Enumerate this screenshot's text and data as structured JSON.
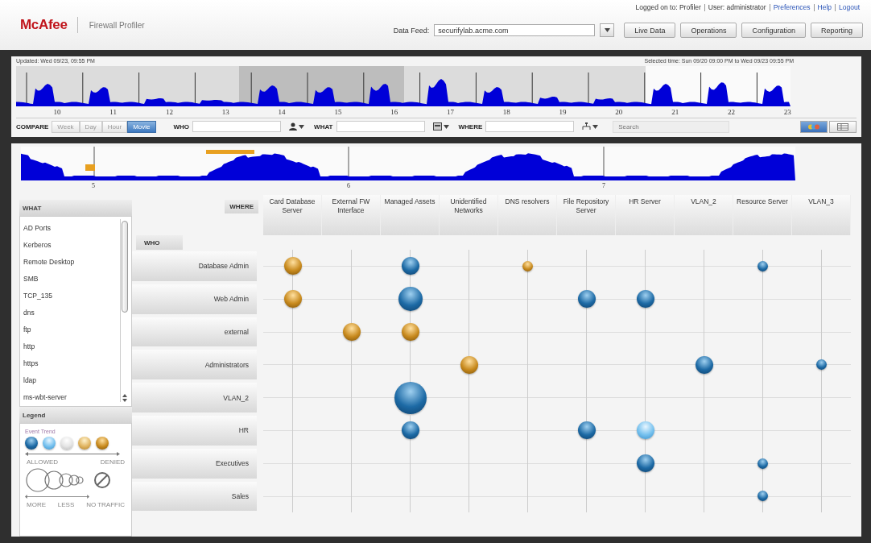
{
  "header": {
    "logo": "McAfee",
    "product": "Firewall Profiler",
    "session": [
      {
        "kind": "text",
        "label": "Logged on to: Profiler"
      },
      {
        "kind": "text",
        "label": "User: administrator"
      },
      {
        "kind": "link",
        "label": "Preferences"
      },
      {
        "kind": "link",
        "label": "Help"
      },
      {
        "kind": "link",
        "label": "Logout"
      }
    ],
    "data_feed": {
      "label": "Data Feed:",
      "value": "securifylab.acme.com"
    },
    "buttons": [
      "Live Data",
      "Operations",
      "Configuration",
      "Reporting"
    ]
  },
  "timeline": {
    "updated": "Updated: Wed 09/23, 09:55 PM",
    "selected_time": "Selected time: Sun 09/20 09:00 PM to Wed 09/23 09:55 PM",
    "ticks": [
      "10",
      "11",
      "12",
      "13",
      "14",
      "15",
      "16",
      "17",
      "18",
      "19",
      "20",
      "21",
      "22",
      "23"
    ]
  },
  "filter_bar": {
    "compare_label": "COMPARE",
    "compare_options": [
      {
        "label": "Week",
        "selected": false
      },
      {
        "label": "Day",
        "selected": false
      },
      {
        "label": "Hour",
        "selected": false
      },
      {
        "label": "Movie",
        "selected": true
      }
    ],
    "who_label": "WHO",
    "what_label": "WHAT",
    "where_label": "WHERE",
    "search": {
      "placeholder": "Search"
    },
    "views": [
      {
        "kind": "bubbles",
        "selected": true
      },
      {
        "kind": "table",
        "selected": false
      }
    ]
  },
  "detail_timeline": {
    "ticks": [
      "5",
      "6",
      "7"
    ]
  },
  "what_panel": {
    "title": "WHAT",
    "items": [
      "AD Ports",
      "Kerberos",
      "Remote Desktop",
      "SMB",
      "TCP_135",
      "dns",
      "ftp",
      "http",
      "https",
      "ldap",
      "ms-wbt-server"
    ]
  },
  "legend": {
    "title": "Legend",
    "trend_label": "Event Trend",
    "allowed": "ALLOWED",
    "denied": "DENIED",
    "more": "MORE",
    "less": "LESS",
    "no_traffic": "NO TRAFFIC"
  },
  "matrix": {
    "where_label": "WHERE",
    "who_label": "WHO",
    "columns": [
      "Card Database Server",
      "External FW Interface",
      "Managed Assets",
      "Unidentified Networks",
      "DNS resolvers",
      "File Repository Server",
      "HR Server",
      "VLAN_2",
      "Resource Server",
      "VLAN_3"
    ],
    "rows": [
      {
        "label": "Database Admin",
        "cells": [
          {
            "kind": "denied-medium"
          },
          {
            "kind": "empty"
          },
          {
            "kind": "allowed-medium"
          },
          {
            "kind": "empty"
          },
          {
            "kind": "denied-small"
          },
          {
            "kind": "empty"
          },
          {
            "kind": "empty"
          },
          {
            "kind": "empty"
          },
          {
            "kind": "allowed-small"
          },
          {
            "kind": "empty"
          }
        ]
      },
      {
        "label": "Web Admin",
        "cells": [
          {
            "kind": "denied-medium"
          },
          {
            "kind": "empty"
          },
          {
            "kind": "allowed-large"
          },
          {
            "kind": "empty"
          },
          {
            "kind": "empty"
          },
          {
            "kind": "allowed-medium"
          },
          {
            "kind": "allowed-medium"
          },
          {
            "kind": "empty"
          },
          {
            "kind": "empty"
          },
          {
            "kind": "empty"
          }
        ]
      },
      {
        "label": "external",
        "cells": [
          {
            "kind": "empty"
          },
          {
            "kind": "denied-medium"
          },
          {
            "kind": "denied-medium"
          },
          {
            "kind": "empty"
          },
          {
            "kind": "empty"
          },
          {
            "kind": "empty"
          },
          {
            "kind": "empty"
          },
          {
            "kind": "empty"
          },
          {
            "kind": "empty"
          },
          {
            "kind": "empty"
          }
        ]
      },
      {
        "label": "Administrators",
        "cells": [
          {
            "kind": "empty"
          },
          {
            "kind": "empty"
          },
          {
            "kind": "empty"
          },
          {
            "kind": "denied-medium"
          },
          {
            "kind": "empty"
          },
          {
            "kind": "empty"
          },
          {
            "kind": "empty"
          },
          {
            "kind": "allowed-medium"
          },
          {
            "kind": "empty"
          },
          {
            "kind": "allowed-small"
          }
        ]
      },
      {
        "label": "VLAN_2",
        "cells": [
          {
            "kind": "empty"
          },
          {
            "kind": "empty"
          },
          {
            "kind": "allowed-huge"
          },
          {
            "kind": "empty"
          },
          {
            "kind": "empty"
          },
          {
            "kind": "empty"
          },
          {
            "kind": "empty"
          },
          {
            "kind": "empty"
          },
          {
            "kind": "empty"
          },
          {
            "kind": "empty"
          }
        ]
      },
      {
        "label": "HR",
        "cells": [
          {
            "kind": "empty"
          },
          {
            "kind": "empty"
          },
          {
            "kind": "allowed-medium"
          },
          {
            "kind": "empty"
          },
          {
            "kind": "empty"
          },
          {
            "kind": "allowed-medium"
          },
          {
            "kind": "trend-medium"
          },
          {
            "kind": "empty"
          },
          {
            "kind": "empty"
          },
          {
            "kind": "empty"
          }
        ]
      },
      {
        "label": "Executives",
        "cells": [
          {
            "kind": "empty"
          },
          {
            "kind": "empty"
          },
          {
            "kind": "empty"
          },
          {
            "kind": "empty"
          },
          {
            "kind": "empty"
          },
          {
            "kind": "empty"
          },
          {
            "kind": "allowed-medium"
          },
          {
            "kind": "empty"
          },
          {
            "kind": "allowed-small"
          },
          {
            "kind": "empty"
          }
        ]
      },
      {
        "label": "Sales",
        "cells": [
          {
            "kind": "empty"
          },
          {
            "kind": "empty"
          },
          {
            "kind": "empty"
          },
          {
            "kind": "empty"
          },
          {
            "kind": "empty"
          },
          {
            "kind": "empty"
          },
          {
            "kind": "empty"
          },
          {
            "kind": "empty"
          },
          {
            "kind": "allowed-small"
          },
          {
            "kind": "empty"
          }
        ]
      }
    ]
  }
}
